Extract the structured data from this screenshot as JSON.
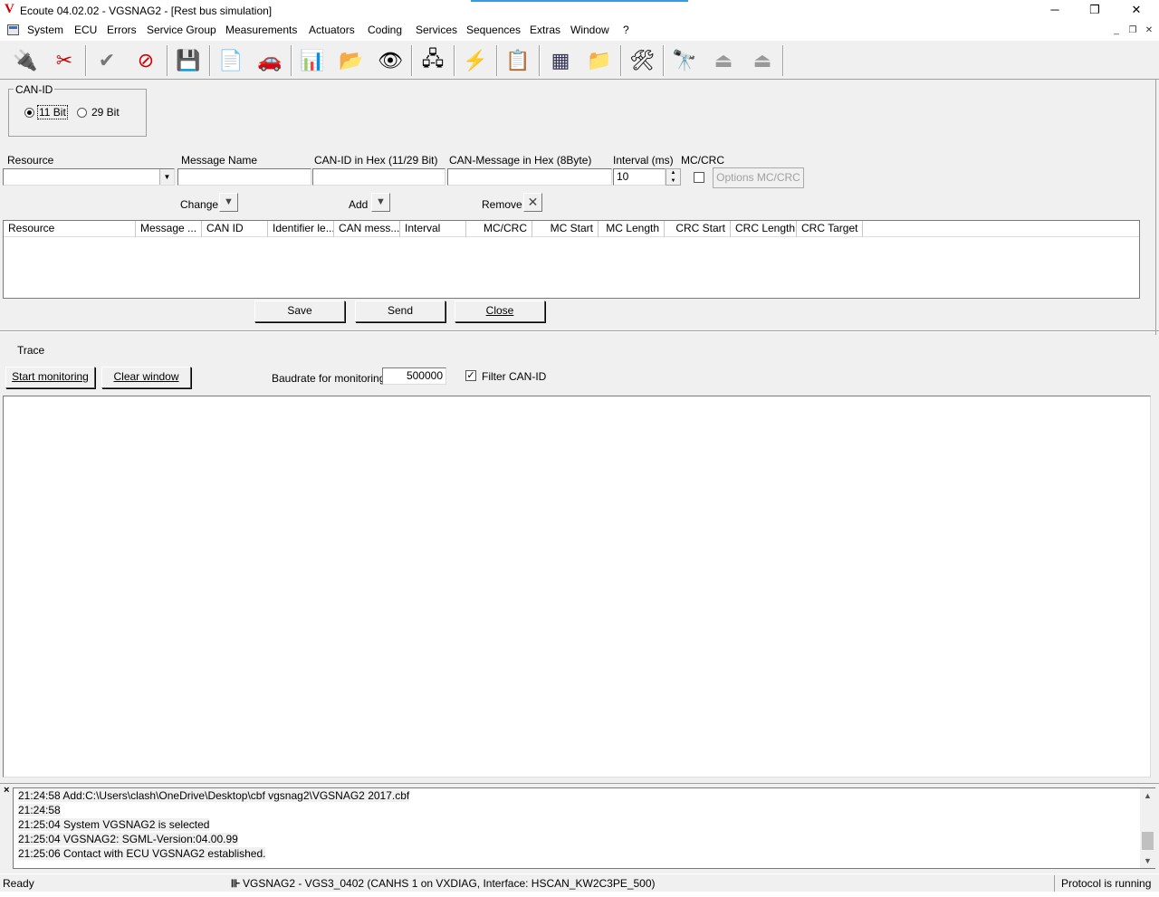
{
  "window": {
    "logo": "V",
    "title": "Ecoute 04.02.02 - VGSNAG2 - [Rest bus simulation]",
    "minimize": "─",
    "maximize": "❐",
    "close": "✕"
  },
  "menu": {
    "items": [
      "System",
      "ECU",
      "Errors",
      "Service Group",
      "Measurements",
      "Actuators",
      "Coding",
      "Services",
      "Sequences",
      "Extras",
      "Window",
      "?"
    ],
    "mdi_min": "_",
    "mdi_restore": "❐",
    "mdi_close": "✕"
  },
  "toolbar": {
    "icons": [
      {
        "name": "connect-icon",
        "glyph": "🔌"
      },
      {
        "name": "disconnect-icon",
        "glyph": "✂"
      },
      {
        "name": "check-icon",
        "glyph": "✔"
      },
      {
        "name": "no-check-icon",
        "glyph": "⊘"
      },
      {
        "name": "ecu-info-icon",
        "glyph": "💾"
      },
      {
        "name": "document-glasses-icon",
        "glyph": "📄"
      },
      {
        "name": "car-icon",
        "glyph": "🚗"
      },
      {
        "name": "measurement-window-icon",
        "glyph": "📊"
      },
      {
        "name": "folder-arrow-icon",
        "glyph": "📂"
      },
      {
        "name": "eye-icon",
        "glyph": "👁"
      },
      {
        "name": "network-icon",
        "glyph": "🖧"
      },
      {
        "name": "lightning-icon",
        "glyph": "⚡"
      },
      {
        "name": "list-document-icon",
        "glyph": "📋"
      },
      {
        "name": "table-icon",
        "glyph": "▦"
      },
      {
        "name": "folder-open-icon",
        "glyph": "📁"
      },
      {
        "name": "tools-icon",
        "glyph": "🛠"
      },
      {
        "name": "binoculars-icon",
        "glyph": "🔭"
      },
      {
        "name": "plug-icon",
        "glyph": "⏏"
      },
      {
        "name": "plug-disabled-icon",
        "glyph": "⏏"
      }
    ]
  },
  "canid": {
    "legend": "CAN-ID",
    "opt11": "11 Bit",
    "opt29": "29 Bit",
    "selected": "11 Bit"
  },
  "form": {
    "resource_label": "Resource",
    "message_name_label": "Message Name",
    "canid_hex_label": "CAN-ID in Hex (11/29 Bit)",
    "canmsg_hex_label": "CAN-Message in Hex (8Byte)",
    "interval_label": "Interval (ms)",
    "mccrc_label": "MC/CRC",
    "interval_value": "10",
    "options_button": "Options MC/CRC",
    "change_label": "Change",
    "add_label": "Add",
    "remove_label": "Remove"
  },
  "table": {
    "columns": [
      "Resource",
      "Message ...",
      "CAN ID",
      "Identifier le...",
      "CAN mess...",
      "Interval",
      "MC/CRC",
      "MC Start",
      "MC Length",
      "CRC Start",
      "CRC Length",
      "CRC Target"
    ]
  },
  "actions": {
    "save": "Save",
    "send": "Send",
    "close": "Close"
  },
  "trace": {
    "title": "Trace",
    "start": "Start monitoring",
    "clear": "Clear window",
    "baud_label": "Baudrate for monitoring:",
    "baud_value": "500000",
    "filter_label": "Filter CAN-ID",
    "filter_checked": "✓"
  },
  "log": {
    "close": "×",
    "lines": [
      "21:24:58 Add:C:\\Users\\clash\\OneDrive\\Desktop\\cbf vgsnag2\\VGSNAG2 2017.cbf",
      "21:24:58",
      "21:25:04 System VGSNAG2 is selected",
      "21:25:04 VGSNAG2: SGML-Version:04.00.99",
      "21:25:06 Contact with ECU VGSNAG2 established."
    ]
  },
  "status": {
    "ready": "Ready",
    "connection": "VGSNAG2 - VGS3_0402 (CANHS 1 on VXDIAG, Interface: HSCAN_KW2C3PE_500)",
    "protocol": "Protocol is running"
  }
}
